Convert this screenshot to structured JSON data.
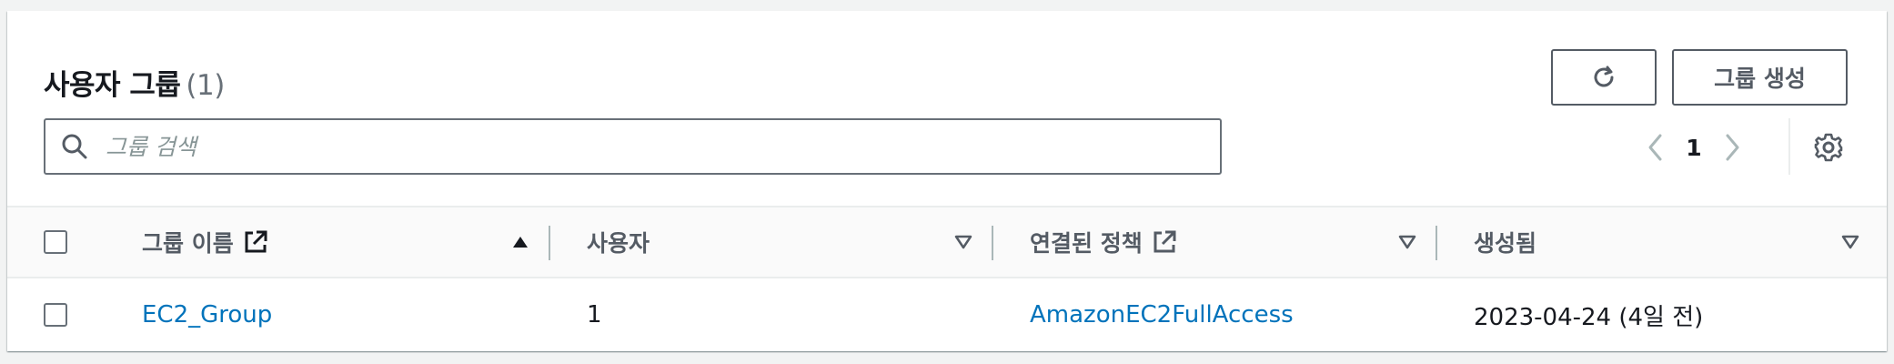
{
  "header": {
    "title": "사용자 그룹",
    "count": "(1)",
    "refresh_icon": "refresh-icon",
    "create_label": "그룹 생성"
  },
  "search": {
    "placeholder": "그룹 검색",
    "icon": "search-icon"
  },
  "pagination": {
    "current_page": "1",
    "prev_icon": "chevron-left-icon",
    "next_icon": "chevron-right-icon",
    "settings_icon": "gear-icon"
  },
  "table": {
    "columns": [
      {
        "label": "그룹 이름",
        "external_icon": true,
        "sort": "ascending"
      },
      {
        "label": "사용자",
        "external_icon": false,
        "sort": "none"
      },
      {
        "label": "연결된 정책",
        "external_icon": true,
        "sort": "none"
      },
      {
        "label": "생성됨",
        "external_icon": false,
        "sort": "none"
      }
    ],
    "rows": [
      {
        "group_name": "EC2_Group",
        "users": "1",
        "policies": "AmazonEC2FullAccess",
        "created": "2023-04-24 (4일 전)"
      }
    ]
  },
  "colors": {
    "link": "#0073bb",
    "border": "#687078",
    "text": "#16191f",
    "muted": "#545b64"
  }
}
